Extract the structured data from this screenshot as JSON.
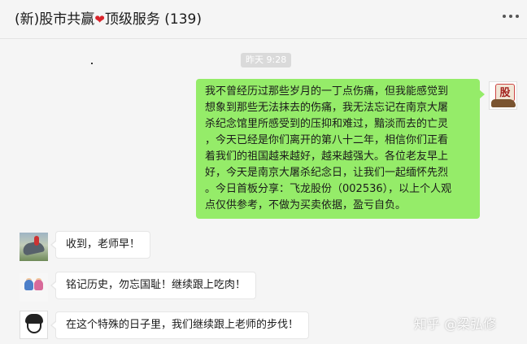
{
  "header": {
    "title": "(新)股市共赢",
    "title_suffix": "顶级服务 (139)",
    "heart": "❤",
    "heart_color": "#d9242b",
    "more_icon": "more-dots-icon"
  },
  "chat": {
    "timestamp": "昨天 9:28",
    "messages": [
      {
        "sender": "self",
        "avatar_icon": "stock-seal-avatar-icon",
        "avatar_text": "股",
        "lines": [
          "我不曾经历过那些岁月的一丁点伤痛，但我能感觉到",
          "想象到那些无法抹去的伤痛，我无法忘记在南京大屠",
          "杀纪念馆里所感受到的压抑和难过，黯淡而去的亡灵",
          "，今天已经是你们离开的第八十二年，相信你们正看",
          "着我们的祖国越来越好，越来越强大。各位老友早上",
          "好，今天是南京大屠杀纪念日，让我们一起缅怀先烈",
          "。今日首板分享：飞龙股份（002536），以上个人观",
          "点仅供参考，不做为买卖依据，盈亏自负。"
        ]
      },
      {
        "sender": "other",
        "avatar_icon": "rock-landscape-avatar-icon",
        "text": "收到，老师早！"
      },
      {
        "sender": "other",
        "avatar_icon": "couple-cartoon-avatar-icon",
        "text": "铭记历史，勿忘国耻！继续跟上吃肉！"
      },
      {
        "sender": "other",
        "avatar_icon": "cartoon-boy-avatar-icon",
        "text": "在这个特殊的日子里，我们继续跟上老师的步伐！"
      }
    ]
  },
  "watermark": "知乎 @梁弘修",
  "colors": {
    "self_bubble": "#95ec69",
    "other_bubble": "#ffffff",
    "background": "#f5f5f5"
  }
}
